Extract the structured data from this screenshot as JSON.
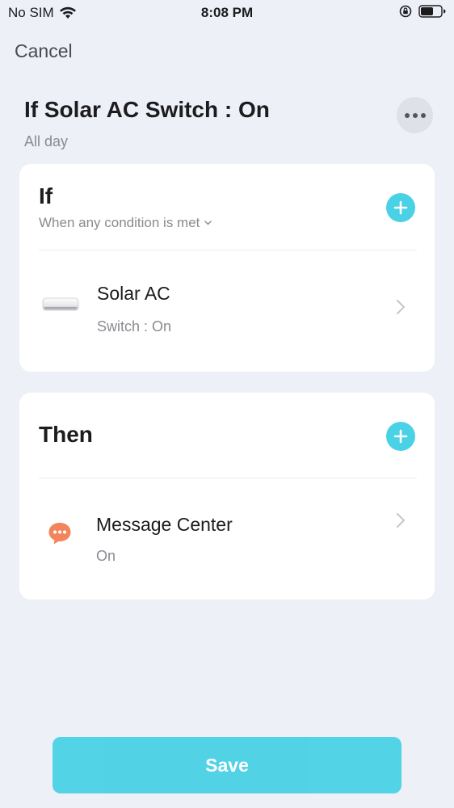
{
  "status_bar": {
    "carrier": "No SIM",
    "time": "8:08 PM"
  },
  "nav": {
    "cancel_label": "Cancel"
  },
  "scene": {
    "title": "If Solar AC Switch : On",
    "schedule": "All day"
  },
  "if_section": {
    "title": "If",
    "condition_mode": "When any condition is met",
    "conditions": [
      {
        "icon": "air-conditioner-icon",
        "label": "Solar AC",
        "detail": "Switch : On"
      }
    ]
  },
  "then_section": {
    "title": "Then",
    "actions": [
      {
        "icon": "message-bubble-icon",
        "label": "Message Center",
        "detail": "On"
      }
    ]
  },
  "footer": {
    "save_label": "Save"
  },
  "colors": {
    "accent": "#49d1e5",
    "background": "#eef0f7",
    "message_icon": "#f3845c"
  }
}
